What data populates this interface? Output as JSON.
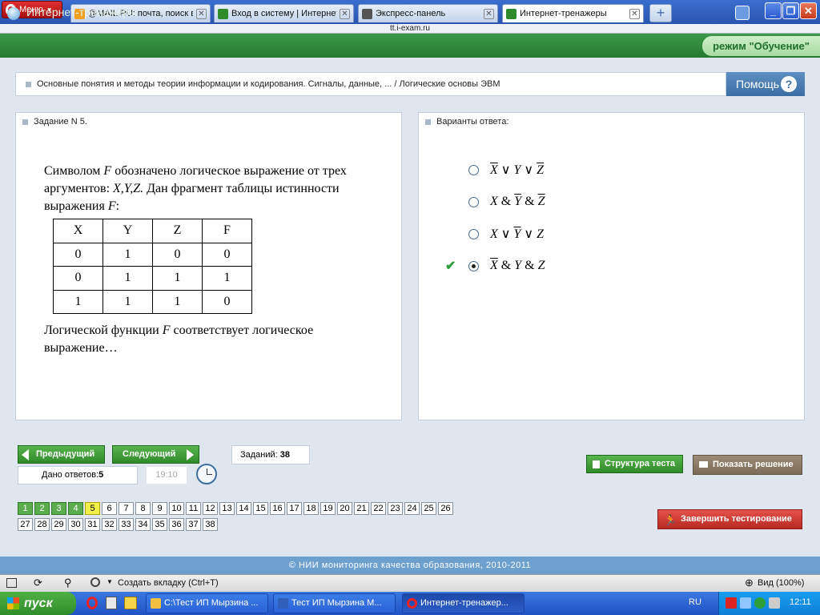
{
  "browser": {
    "menu_label": "Меню",
    "tabs": [
      {
        "title": "@MAIL.RU: почта, поиск в интернете...",
        "close": "✕",
        "color": "#f0a020"
      },
      {
        "title": "Вход в систему | Интернет-тренажеры",
        "close": "✕",
        "color": "#2f8a2a"
      },
      {
        "title": "Экспресс-панель",
        "close": "✕",
        "color": "#555555"
      },
      {
        "title": "Интернет-тренажеры",
        "close": "✕",
        "color": "#2f8a2a"
      }
    ],
    "new_tab": "+",
    "address": "tt.i-exam.ru",
    "window_buttons": [
      "_",
      "❐",
      "✕"
    ]
  },
  "header": {
    "title": "Интернет-тренажеры",
    "mode": "режим \"Обучение\""
  },
  "breadcrumb": "Основные понятия и методы теории информации и кодирования. Сигналы, данные, ... / Логические основы ЭВМ",
  "help": {
    "label": "Помощь",
    "icon": "?"
  },
  "question": {
    "title": "Задание N 5.",
    "text_parts": [
      "Символом ",
      "F",
      " обозначено логическое выражение от трех аргументов: ",
      "X,Y,Z.",
      " Дан фрагмент таблицы истинности выражения ",
      "F",
      ":"
    ],
    "table": {
      "headers": [
        "X",
        "Y",
        "Z",
        "F"
      ],
      "rows": [
        [
          "0",
          "1",
          "0",
          "0"
        ],
        [
          "0",
          "1",
          "1",
          "1"
        ],
        [
          "1",
          "1",
          "1",
          "0"
        ]
      ]
    },
    "footer_parts": [
      "Логической функции ",
      "F",
      " соответствует логическое выражение…"
    ]
  },
  "answers": {
    "title": "Варианты ответа:",
    "options": [
      {
        "selected": false,
        "parts": [
          {
            "t": "X",
            "bar": true
          },
          {
            "t": " ∨ ",
            "bar": false
          },
          {
            "t": "Y",
            "bar": false
          },
          {
            "t": " ∨ ",
            "bar": false
          },
          {
            "t": "Z",
            "bar": true
          }
        ]
      },
      {
        "selected": false,
        "parts": [
          {
            "t": "X",
            "bar": false
          },
          {
            "t": " & ",
            "bar": false
          },
          {
            "t": "Y",
            "bar": true
          },
          {
            "t": " & ",
            "bar": false
          },
          {
            "t": "Z",
            "bar": true
          }
        ]
      },
      {
        "selected": false,
        "parts": [
          {
            "t": "X",
            "bar": false
          },
          {
            "t": " ∨ ",
            "bar": false
          },
          {
            "t": "Y",
            "bar": true
          },
          {
            "t": " ∨ ",
            "bar": false
          },
          {
            "t": "Z",
            "bar": false
          }
        ]
      },
      {
        "selected": true,
        "parts": [
          {
            "t": "X",
            "bar": true
          },
          {
            "t": " & ",
            "bar": false
          },
          {
            "t": "Y",
            "bar": false
          },
          {
            "t": " & ",
            "bar": false
          },
          {
            "t": "Z",
            "bar": false
          }
        ]
      }
    ],
    "check_mark": "✔"
  },
  "controls": {
    "prev": "Предыдущий",
    "next": "Следующий",
    "tasks_label": "Заданий:",
    "tasks_count": "38",
    "answered_label": "Дано ответов:",
    "answered_count": "5",
    "time": "19:10",
    "structure": "Структура теста",
    "show_solution": "Показать решение",
    "finish": "Завершить тестирование"
  },
  "task_numbers": {
    "total": 38,
    "done": [
      1,
      2,
      3,
      4
    ],
    "current": 5
  },
  "footer": "© НИИ мониторинга качества образования, 2010-2011",
  "statusbar": {
    "new_tab": "Создать вкладку (Ctrl+T)",
    "zoom": "Вид (100%)"
  },
  "taskbar": {
    "start": "пуск",
    "tasks": [
      {
        "label": "C:\\Тест ИП Мырзина ...",
        "color": "#f0c040"
      },
      {
        "label": "Тест ИП Мырзина М...",
        "color": "#2f5fb8"
      },
      {
        "label": "Интернет-тренажер...",
        "color": "#d22"
      }
    ],
    "lang": "RU",
    "clock": "12:11"
  }
}
